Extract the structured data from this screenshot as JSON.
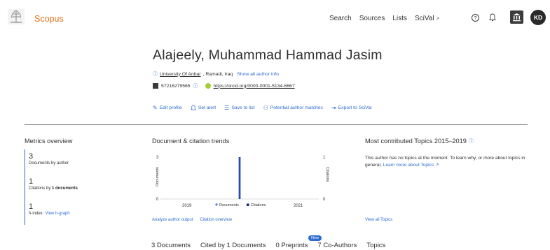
{
  "nav": {
    "brand": "Scopus",
    "links": [
      "Search",
      "Sources",
      "Lists",
      "SciVal"
    ],
    "scival_ext": "↗",
    "help_glyph": "?",
    "avatar_initials": "KD"
  },
  "author": {
    "name": "Alajeely, Muhammad Hammad Jasim",
    "affiliation": "University Of Anbar",
    "location": ", Ramadi, Iraq",
    "show_all": "Show all author info",
    "scopus_id": "57216279565",
    "orcid_url": "https://orcid.org/0000-0001-5134-6667"
  },
  "actions": {
    "edit_profile": "Edit profile",
    "set_alert": "Set alert",
    "save_to_list": "Save to list",
    "potential_matches": "Potential author matches",
    "export_scival": "Export to SciVal"
  },
  "metrics": {
    "title": "Metrics overview",
    "documents_value": "3",
    "documents_label": "Documents by author",
    "citations_value": "1",
    "citations_label_prefix": "Citations by ",
    "citations_label_bold": "1 documents",
    "hindex_value": "1",
    "hindex_label": "h-index:",
    "hindex_link": "View h-graph"
  },
  "trends": {
    "title": "Document & citation trends",
    "analyze_link": "Analyze author output",
    "citation_link": "Citation overview"
  },
  "chart_data": {
    "type": "bar",
    "x_ticks": [
      "2019",
      "2021"
    ],
    "y_left_label": "Documents",
    "y_right_label": "Citations",
    "y_left_ticks": [
      "3",
      "0"
    ],
    "y_right_ticks": [
      "1",
      "0"
    ],
    "legend": [
      "Documents",
      "Citations"
    ],
    "colors": {
      "documents": "#4a7fd6",
      "citations": "#1b2a6b"
    },
    "series": [
      {
        "name": "Documents",
        "x": [
          2020
        ],
        "values": [
          3
        ]
      },
      {
        "name": "Citations",
        "x": [
          2020
        ],
        "values": [
          1
        ]
      }
    ]
  },
  "topics": {
    "title": "Most contributed Topics 2015–2019",
    "text": "This author has no topics at the moment. To learn why, or more about topics in general, ",
    "learn_more": "Learn more about Topics ↗",
    "view_all": "View all Topics"
  },
  "tabs": {
    "documents": "3 Documents",
    "cited_by": "Cited by 1 Documents",
    "preprints": "0 Preprints",
    "coauthors": "7 Co-Authors",
    "topics": "Topics",
    "new_badge": "New"
  }
}
